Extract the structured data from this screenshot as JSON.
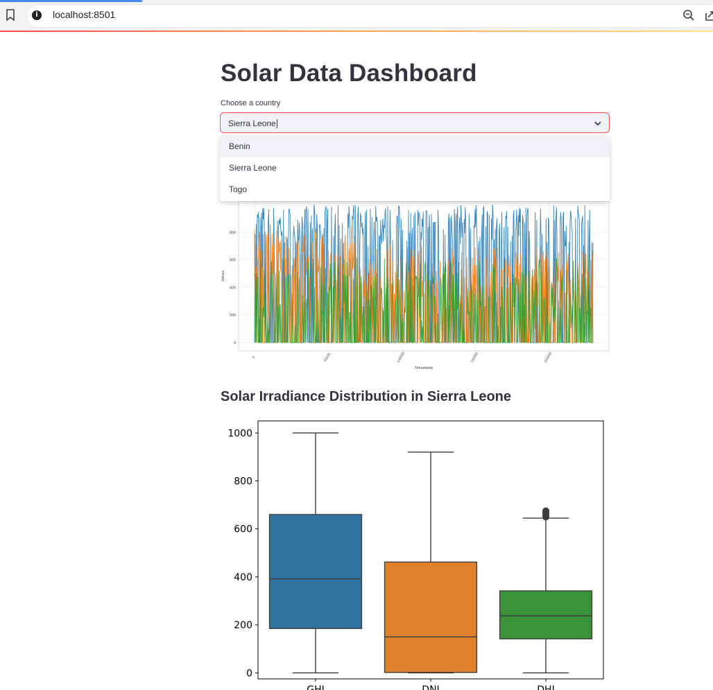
{
  "browser": {
    "url": "localhost:8501",
    "info_glyph": "i"
  },
  "app": {
    "title": "Solar Data Dashboard",
    "select": {
      "label": "Choose a country",
      "value": "Sierra Leone",
      "options": [
        "Benin",
        "Sierra Leone",
        "Togo"
      ],
      "highlighted_option": "Benin"
    },
    "boxplot_section_title": "Solar Irradiance Distribution in Sierra Leone"
  },
  "colors": {
    "ghi": "#1f77b4",
    "dni": "#ff7f0e",
    "dhi": "#2ca02c",
    "box_ghi": "#3274a1",
    "box_dni": "#e1812c",
    "box_dhi": "#3a923a",
    "accent": "#ff4b4b"
  },
  "icons": [
    "bookmark-icon",
    "info-icon",
    "zoom-out-icon",
    "share-icon",
    "chevron-down-icon"
  ],
  "chart_data": [
    {
      "type": "line",
      "xlabel": "Timestamp",
      "ylabel": "Values",
      "x_ticks": [
        0,
        50000,
        100000,
        150000,
        200000
      ],
      "y_ticks": [
        0,
        200,
        400,
        600,
        800
      ],
      "xlim": [
        0,
        230000
      ],
      "ylim": [
        0,
        1000
      ],
      "series_colors": [
        "#1f77b4",
        "#ff7f0e",
        "#2ca02c"
      ],
      "partially_hidden_by_dropdown": true
    },
    {
      "type": "boxplot",
      "categories": [
        "GHI",
        "DNI",
        "DHI"
      ],
      "y_ticks": [
        0,
        200,
        400,
        600,
        800,
        1000
      ],
      "ylim": [
        -25,
        1050
      ],
      "boxes": [
        {
          "name": "GHI",
          "whisker_low": 0,
          "q1": 185,
          "median": 392,
          "q3": 660,
          "whisker_high": 1000,
          "outliers": []
        },
        {
          "name": "DNI",
          "whisker_low": 0,
          "q1": 2,
          "median": 150,
          "q3": 462,
          "whisker_high": 920,
          "outliers": []
        },
        {
          "name": "DHI",
          "whisker_low": 0,
          "q1": 142,
          "median": 238,
          "q3": 342,
          "whisker_high": 645,
          "outliers": [
            650,
            655,
            660,
            665,
            670,
            675
          ]
        }
      ]
    }
  ]
}
